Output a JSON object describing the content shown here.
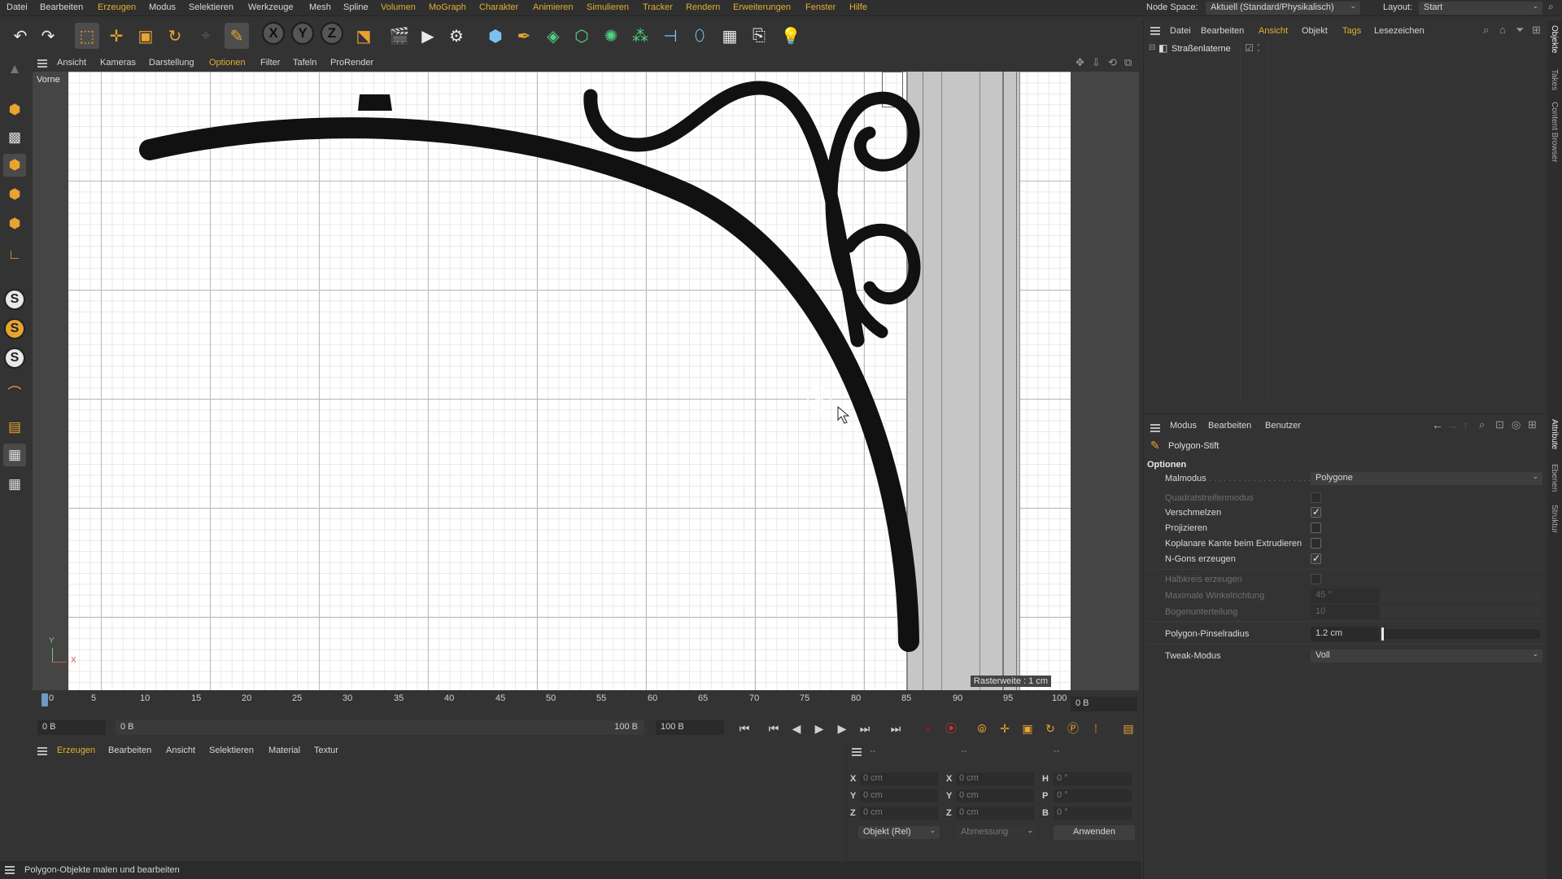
{
  "menubar": {
    "items": [
      "Datei",
      "Bearbeiten",
      "Erzeugen",
      "Modus",
      "Selektieren",
      "Werkzeuge",
      "Mesh",
      "Spline",
      "Volumen",
      "MoGraph",
      "Charakter",
      "Animieren",
      "Simulieren",
      "Tracker",
      "Rendern",
      "Erweiterungen",
      "Fenster",
      "Hilfe"
    ],
    "node_space_label": "Node Space:",
    "node_space_value": "Aktuell (Standard/Physikalisch)",
    "layout_label": "Layout:",
    "layout_value": "Start"
  },
  "toolbar": {
    "axis_x": "X",
    "axis_y": "Y",
    "axis_z": "Z"
  },
  "viewport": {
    "menu": [
      "Ansicht",
      "Kameras",
      "Darstellung",
      "Optionen",
      "Filter",
      "Tafeln",
      "ProRender"
    ],
    "active_menu": "Optionen",
    "view_name": "Vorne",
    "grid_label": "Rasterweite : 1 cm",
    "axis_y": "Y",
    "axis_x": "X"
  },
  "timeline": {
    "ticks": [
      "0",
      "5",
      "10",
      "15",
      "20",
      "25",
      "30",
      "35",
      "40",
      "45",
      "50",
      "55",
      "60",
      "65",
      "70",
      "75",
      "80",
      "85",
      "90",
      "95",
      "100"
    ],
    "current_frame": "0 B",
    "start_field": "0 B",
    "range_start": "0 B",
    "range_end": "100 B",
    "end_field": "100 B"
  },
  "material_manager": {
    "menu": [
      "Erzeugen",
      "Bearbeiten",
      "Ansicht",
      "Selektieren",
      "Material",
      "Textur"
    ],
    "active_menu": "Erzeugen"
  },
  "coordinates": {
    "header_a": "--",
    "header_b": "--",
    "header_c": "--",
    "rows": [
      {
        "label": "X",
        "pos": "0 cm",
        "label2": "X",
        "size": "0 cm",
        "label3": "H",
        "rot": "0 °"
      },
      {
        "label": "Y",
        "pos": "0 cm",
        "label2": "Y",
        "size": "0 cm",
        "label3": "P",
        "rot": "0 °"
      },
      {
        "label": "Z",
        "pos": "0 cm",
        "label2": "Z",
        "size": "0 cm",
        "label3": "B",
        "rot": "0 °"
      }
    ],
    "mode_select": "Objekt (Rel)",
    "size_select": "Abmessung",
    "apply_button": "Anwenden"
  },
  "status_bar": {
    "text": "Polygon-Objekte malen und bearbeiten"
  },
  "object_manager": {
    "menu": [
      "Datei",
      "Bearbeiten",
      "Ansicht",
      "Objekt",
      "Tags",
      "Lesezeichen"
    ],
    "active_menu": "Ansicht",
    "objects": [
      {
        "name": "Straßenlaterne"
      }
    ]
  },
  "attribute_manager": {
    "menu": [
      "Modus",
      "Bearbeiten",
      "Benutzer"
    ],
    "tool_name": "Polygon-Stift",
    "section": "Optionen",
    "malmodus_label": "Malmodus",
    "malmodus_value": "Polygone",
    "options": [
      {
        "label": "Quadratstreifenmodus",
        "checked": false,
        "enabled": false
      },
      {
        "label": "Verschmelzen",
        "checked": true,
        "enabled": true
      },
      {
        "label": "Projizieren",
        "checked": false,
        "enabled": true
      },
      {
        "label": "Koplanare Kante beim Extrudieren",
        "checked": false,
        "enabled": true
      },
      {
        "label": "N-Gons erzeugen",
        "checked": true,
        "enabled": true
      }
    ],
    "halbkreis_label": "Halbkreis erzeugen",
    "max_winkel_label": "Maximale Winkelrichtung",
    "max_winkel_value": "45 °",
    "bogen_label": "Bogenunterteilung",
    "bogen_value": "10",
    "pinsel_label": "Polygon-Pinselradius",
    "pinsel_value": "1.2 cm",
    "tweak_label": "Tweak-Modus",
    "tweak_value": "Voll"
  },
  "side_tabs": {
    "top": [
      "Objekte",
      "Takes",
      "Content Browser"
    ],
    "bottom": [
      "Attribute",
      "Ebenen",
      "Struktur"
    ]
  },
  "colors": {
    "accent": "#e0b030",
    "background": "#333333"
  }
}
